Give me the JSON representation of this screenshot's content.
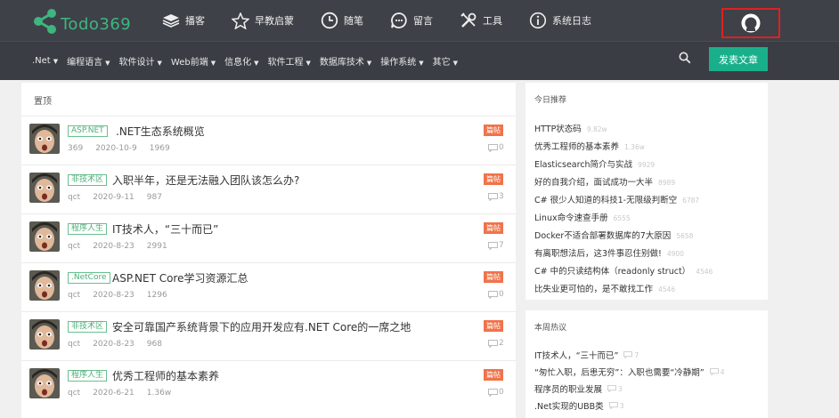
{
  "site": {
    "name": "Todo369"
  },
  "topnav": [
    {
      "label": "播客",
      "icon": "stack-icon"
    },
    {
      "label": "早教启蒙",
      "icon": "star-icon"
    },
    {
      "label": "随笔",
      "icon": "clock-icon"
    },
    {
      "label": "留言",
      "icon": "message-icon"
    },
    {
      "label": "工具",
      "icon": "tools-icon"
    },
    {
      "label": "系统日志",
      "icon": "info-icon"
    }
  ],
  "categories": [
    ".Net",
    "编程语言",
    "软件设计",
    "Web前端",
    "信息化",
    "软件工程",
    "数据库技术",
    "操作系统",
    "其它"
  ],
  "publish_label": "发表文章",
  "main": {
    "section_title": "置顶",
    "hot_label": "篇帖",
    "posts": [
      {
        "tag": "ASP.NET",
        "title": ".NET生态系统概览",
        "author": "369",
        "date": "2020-10-9",
        "views": "1969",
        "comments": "0"
      },
      {
        "tag": "非技术区",
        "title": "入职半年，还是无法融入团队该怎么办?",
        "author": "qct",
        "date": "2020-9-11",
        "views": "987",
        "comments": "3"
      },
      {
        "tag": "程序人生",
        "title": "IT技术人，“三十而已”",
        "author": "qct",
        "date": "2020-8-23",
        "views": "2991",
        "comments": "7"
      },
      {
        "tag": ".NetCore",
        "title": "ASP.NET Core学习资源汇总",
        "author": "qct",
        "date": "2020-8-23",
        "views": "1296",
        "comments": "0"
      },
      {
        "tag": "非技术区",
        "title": "安全可靠国产系统背景下的应用开发应有.NET Core的一席之地",
        "author": "qct",
        "date": "2020-8-23",
        "views": "968",
        "comments": "2"
      },
      {
        "tag": "程序人生",
        "title": "优秀工程师的基本素养",
        "author": "qct",
        "date": "2020-6-21",
        "views": "1.36w",
        "comments": "0"
      }
    ]
  },
  "recommend": {
    "title": "今日推荐",
    "items": [
      {
        "title": "HTTP状态码",
        "count": "9.82w"
      },
      {
        "title": "优秀工程师的基本素养",
        "count": "1.36w"
      },
      {
        "title": "Elasticsearch简介与实战",
        "count": "9929"
      },
      {
        "title": "好的自我介绍，面试成功一大半",
        "count": "8989"
      },
      {
        "title": "C# 很少人知道的科技1-无限级判断空",
        "count": "6787"
      },
      {
        "title": "Linux命令速查手册",
        "count": "6555"
      },
      {
        "title": "Docker不适合部署数据库的7大原因",
        "count": "5658"
      },
      {
        "title": "有离职想法后，这3件事忍住别做!",
        "count": "4900"
      },
      {
        "title": "C# 中的只读结构体（readonly struct）",
        "count": "4546"
      },
      {
        "title": "比失业更可怕的，是不敢找工作",
        "count": "4546"
      }
    ]
  },
  "weekly": {
    "title": "本周热议",
    "items": [
      {
        "title": "IT技术人，“三十而已”",
        "count": "7"
      },
      {
        "title": "“匆忙入职，后患无穷”：入职也需要“冷静期”",
        "count": "4"
      },
      {
        "title": "程序员的职业发展",
        "count": "3"
      },
      {
        "title": ".Net实现的UBB类",
        "count": "3"
      }
    ]
  },
  "colors": {
    "topbar": "#3e4148",
    "accent": "#1aaf8b",
    "logo": "#3fb580",
    "hot": "#f0734a",
    "tag": "#4caf78"
  }
}
